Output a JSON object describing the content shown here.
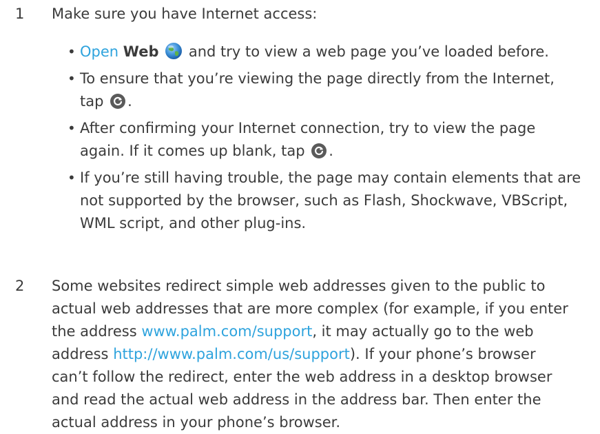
{
  "steps": [
    {
      "number": "1",
      "text": "Make sure you have Internet access:",
      "bullets": [
        {
          "open_link": "Open",
          "web_label": "Web",
          "rest": "and try to view a web page you’ve loaded before.",
          "icon": "globe-icon"
        },
        {
          "line1": "To ensure that you’re viewing the page directly from the Internet,",
          "line2": "tap",
          "line2_end": ".",
          "icon": "refresh-icon"
        },
        {
          "line1": "After confirming your Internet connection, try to view the page",
          "line2": "again. If it comes up blank, tap",
          "line2_end": ".",
          "icon": "refresh-icon"
        },
        {
          "line1": "If you’re still having trouble, the page may contain elements that are",
          "line2": "not supported by the browser, such as Flash, Shockwave, VBScript,",
          "line3": "WML script, and other plug-ins."
        }
      ]
    },
    {
      "number": "2",
      "lines": [
        "Some websites redirect simple web addresses given to the public to",
        "actual web addresses that are more complex (for example, if you enter",
        "the address ",
        "www.palm.com/support",
        ", it may actually go to the web",
        "address ",
        "http://www.palm.com/us/support",
        "). If your phone’s browser",
        "can’t follow the redirect, enter the web address in a desktop browser",
        "and read the actual web address in the address bar. Then enter the",
        "actual address in your phone’s browser."
      ]
    }
  ],
  "colors": {
    "text": "#3b3b3b",
    "link": "#2ea3dd",
    "refresh_icon": "#5a5a5a",
    "globe_icon": "#3b8fd6"
  }
}
